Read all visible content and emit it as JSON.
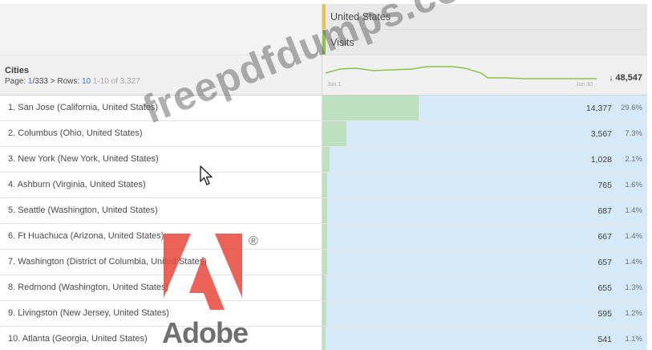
{
  "segment": {
    "label": "United States"
  },
  "metric": {
    "label": "Visits"
  },
  "dimension": {
    "title": "Cities",
    "page_prefix": "Page:",
    "page_current": "1",
    "page_total": "/333",
    "page_arrow": ">",
    "rows_prefix": "Rows:",
    "rows_value": "10",
    "range": "1-10 of 3,327"
  },
  "sparkline": {
    "start_label": "Jun 1",
    "end_label": "Jun 30"
  },
  "total": {
    "arrow": "↓",
    "value": "48,547"
  },
  "rows": [
    {
      "label": "1. San Jose (California, United States)",
      "value": "14,377",
      "pct": "29.6%",
      "share": 0.296
    },
    {
      "label": "2. Columbus (Ohio, United States)",
      "value": "3,567",
      "pct": "7.3%",
      "share": 0.073
    },
    {
      "label": "3. New York (New York, United States)",
      "value": "1,028",
      "pct": "2.1%",
      "share": 0.021
    },
    {
      "label": "4. Ashburn (Virginia, United States)",
      "value": "765",
      "pct": "1.6%",
      "share": 0.016
    },
    {
      "label": "5. Seattle (Washington, United States)",
      "value": "687",
      "pct": "1.4%",
      "share": 0.014
    },
    {
      "label": "6. Ft Huachuca (Arizona, United States)",
      "value": "667",
      "pct": "1.4%",
      "share": 0.014
    },
    {
      "label": "7. Washington (District of Columbia, United States)",
      "value": "657",
      "pct": "1.4%",
      "share": 0.014
    },
    {
      "label": "8. Redmond (Washington, United States)",
      "value": "655",
      "pct": "1.3%",
      "share": 0.013
    },
    {
      "label": "9. Livingston (New Jersey, United States)",
      "value": "595",
      "pct": "1.2%",
      "share": 0.012
    },
    {
      "label": "10. Atlanta (Georgia, United States)",
      "value": "541",
      "pct": "1.1%",
      "share": 0.011
    }
  ],
  "overlay": {
    "watermark": "freepdfdumps.com",
    "logo_text": "Adobe",
    "registered": "®"
  },
  "colors": {
    "segment_accent": "#e9c44a",
    "metric_accent": "#8bc34a",
    "bar_fill": "#bde0bf",
    "cell_background": "#d6e9f8",
    "adobe_red": "#e8473c"
  }
}
